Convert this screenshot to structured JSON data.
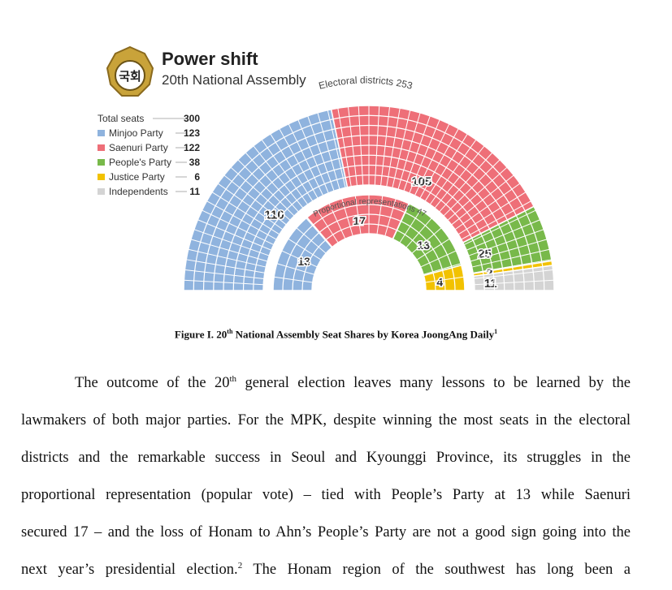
{
  "figure": {
    "emblem_text": "국회",
    "title": "Power shift",
    "subtitle": "20th National Assembly",
    "legend": [
      {
        "label": "Total seats",
        "value": "300",
        "color": ""
      },
      {
        "label": "Minjoo Party",
        "value": "123",
        "color": "#8fb3de"
      },
      {
        "label": "Saenuri Party",
        "value": "122",
        "color": "#ee6f78"
      },
      {
        "label": "People's Party",
        "value": "38",
        "color": "#78b94a"
      },
      {
        "label": "Justice Party",
        "value": "6",
        "color": "#f2c200"
      },
      {
        "label": "Independents",
        "value": "11",
        "color": "#d4d4d4"
      }
    ],
    "outer_label": "Electoral districts 253",
    "inner_label": "Proportional representations 47"
  },
  "chart_data": [
    {
      "type": "pie",
      "title": "Electoral districts 253",
      "categories": [
        "Minjoo Party",
        "Saenuri Party",
        "People's Party",
        "Justice Party",
        "Independents"
      ],
      "values": [
        110,
        105,
        25,
        2,
        11
      ],
      "colors": [
        "#8fb3de",
        "#ee6f78",
        "#78b94a",
        "#f2c200",
        "#d4d4d4"
      ]
    },
    {
      "type": "pie",
      "title": "Proportional representations 47",
      "categories": [
        "Minjoo Party",
        "Saenuri Party",
        "People's Party",
        "Justice Party"
      ],
      "values": [
        13,
        17,
        13,
        4
      ],
      "colors": [
        "#8fb3de",
        "#ee6f78",
        "#78b94a",
        "#f2c200"
      ]
    }
  ],
  "caption": {
    "prefix": "Figure I. 20",
    "sup1": "th",
    "rest": " National Assembly Seat Shares by Korea JoongAng Daily",
    "sup2": "1"
  },
  "body": {
    "l1a": "The outcome of the 20",
    "l1sup": "th",
    "l1b": " general election leaves many lessons to be learned by the",
    "l2": "lawmakers of both major parties. For the MPK, despite winning the most seats in the electoral",
    "l3": "districts and the remarkable success in Seoul and Kyounggi Province, its struggles in the",
    "l4": "proportional representation (popular vote) – tied with People’s Party at 13 while Saenuri",
    "l5": "secured 17 – and the loss of Honam to Ahn’s People’s Party are not a good sign going into the",
    "l6a": "next year’s presidential election.",
    "l6sup": "2",
    "l6b": " The Honam region of the southwest has long been a"
  }
}
